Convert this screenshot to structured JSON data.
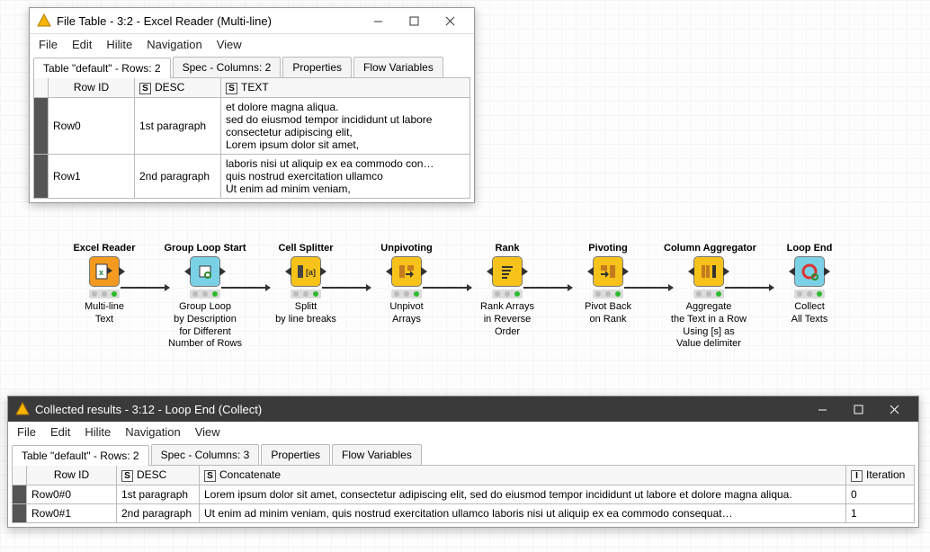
{
  "window1": {
    "title": "File Table - 3:2 - Excel Reader (Multi-line)",
    "menu": [
      "File",
      "Edit",
      "Hilite",
      "Navigation",
      "View"
    ],
    "tabs": [
      "Table \"default\" - Rows: 2",
      "Spec - Columns: 2",
      "Properties",
      "Flow Variables"
    ],
    "cols": {
      "rowid": "Row ID",
      "desc": "DESC",
      "text": "TEXT",
      "s": "S"
    },
    "rows": [
      {
        "id": "Row0",
        "desc": "1st paragraph",
        "text": "et dolore magna aliqua.\nsed do eiusmod tempor incididunt ut labore\nconsectetur adipiscing elit,\nLorem ipsum dolor sit amet,"
      },
      {
        "id": "Row1",
        "desc": "2nd paragraph",
        "text": "laboris nisi ut aliquip ex ea commodo con…\nquis nostrud exercitation ullamco\nUt enim ad minim veniam,"
      }
    ]
  },
  "window2": {
    "title": "Collected results - 3:12 - Loop End (Collect)",
    "menu": [
      "File",
      "Edit",
      "Hilite",
      "Navigation",
      "View"
    ],
    "tabs": [
      "Table \"default\" - Rows: 2",
      "Spec - Columns: 3",
      "Properties",
      "Flow Variables"
    ],
    "cols": {
      "rowid": "Row ID",
      "desc": "DESC",
      "concat": "Concatenate",
      "iter": "Iteration",
      "s": "S",
      "i": "I"
    },
    "rows": [
      {
        "id": "Row0#0",
        "desc": "1st paragraph",
        "concat": "Lorem ipsum dolor sit amet, consectetur adipiscing elit, sed do eiusmod tempor incididunt ut labore et dolore magna aliqua.",
        "iter": "0"
      },
      {
        "id": "Row0#1",
        "desc": "2nd paragraph",
        "concat": "Ut enim ad minim veniam, quis nostrud exercitation ullamco laboris nisi ut aliquip ex ea commodo consequat…",
        "iter": "1"
      }
    ]
  },
  "nodes": [
    {
      "title": "Excel Reader",
      "desc": "Multi-line\nText",
      "color": "#f39a1f",
      "kind": "excel",
      "in": false,
      "out": true
    },
    {
      "title": "Group Loop Start",
      "desc": "Group Loop\nby Description\nfor Different\nNumber of Rows",
      "color": "#7ad1e6",
      "kind": "loopstart",
      "in": true,
      "out": true
    },
    {
      "title": "Cell Splitter",
      "desc": "Splitt\nby line breaks",
      "color": "#f7c21a",
      "kind": "splitter",
      "in": true,
      "out": true
    },
    {
      "title": "Unpivoting",
      "desc": "Unpivot\nArrays",
      "color": "#f7c21a",
      "kind": "unpivot",
      "in": true,
      "out": true
    },
    {
      "title": "Rank",
      "desc": "Rank Arrays\nin Reverse\nOrder",
      "color": "#f7c21a",
      "kind": "rank",
      "in": true,
      "out": true
    },
    {
      "title": "Pivoting",
      "desc": "Pivot Back\non Rank",
      "color": "#f7c21a",
      "kind": "pivot",
      "in": true,
      "out": true
    },
    {
      "title": "Column Aggregator",
      "desc": "Aggregate\nthe Text in a Row\nUsing [s] as\nValue delimiter",
      "color": "#f7c21a",
      "kind": "aggregate",
      "in": true,
      "out": true
    },
    {
      "title": "Loop End",
      "desc": "Collect\nAll Texts",
      "color": "#7ad1e6",
      "kind": "loopend",
      "in": true,
      "out": true
    }
  ]
}
